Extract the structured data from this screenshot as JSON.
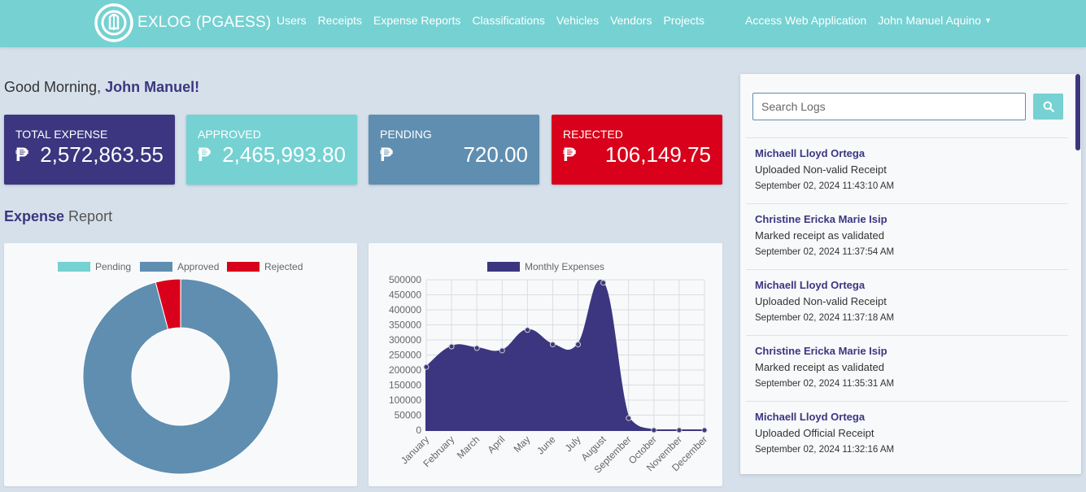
{
  "nav": {
    "brand": "EXLOG (PGAESS)",
    "links": [
      "Users",
      "Receipts",
      "Expense Reports",
      "Classifications",
      "Vehicles",
      "Vendors",
      "Projects"
    ],
    "access": "Access Web Application",
    "user": "John Manuel Aquino"
  },
  "greeting": {
    "prefix": "Good Morning, ",
    "name": "John Manuel!"
  },
  "cards": [
    {
      "title": "TOTAL EXPENSE",
      "currency": "₱",
      "value": "2,572,863.55",
      "color": "#3c3680"
    },
    {
      "title": "APPROVED",
      "currency": "₱",
      "value": "2,465,993.80",
      "color": "#76d1d2"
    },
    {
      "title": "PENDING",
      "currency": "₱",
      "value": "720.00",
      "color": "#5f8eb0"
    },
    {
      "title": "REJECTED",
      "currency": "₱",
      "value": "106,149.75",
      "color": "#d8001a"
    }
  ],
  "section": {
    "bold": "Expense",
    "rest": " Report"
  },
  "search": {
    "placeholder": "Search Logs",
    "value": ""
  },
  "logs": [
    {
      "user": "Michaell Lloyd Ortega",
      "action": "Uploaded Non-valid Receipt",
      "time": "September 02, 2024 11:43:10 AM"
    },
    {
      "user": "Christine Ericka Marie Isip",
      "action": "Marked receipt as validated",
      "time": "September 02, 2024 11:37:54 AM"
    },
    {
      "user": "Michaell Lloyd Ortega",
      "action": "Uploaded Non-valid Receipt",
      "time": "September 02, 2024 11:37:18 AM"
    },
    {
      "user": "Christine Ericka Marie Isip",
      "action": "Marked receipt as validated",
      "time": "September 02, 2024 11:35:31 AM"
    },
    {
      "user": "Michaell Lloyd Ortega",
      "action": "Uploaded Official Receipt",
      "time": "September 02, 2024 11:32:16 AM"
    }
  ],
  "chart_data": [
    {
      "type": "pie",
      "categories": [
        "Pending",
        "Approved",
        "Rejected"
      ],
      "values": [
        720.0,
        2465993.8,
        106149.75
      ],
      "colors": [
        "#76d1d2",
        "#5f8eb0",
        "#d8001a"
      ],
      "legend": "top"
    },
    {
      "type": "area",
      "categories": [
        "January",
        "February",
        "March",
        "April",
        "May",
        "June",
        "July",
        "August",
        "September",
        "October",
        "November",
        "December"
      ],
      "series": [
        {
          "name": "Monthly Expenses",
          "values": [
            210000,
            278000,
            273000,
            265000,
            333000,
            285000,
            285000,
            490000,
            40000,
            0,
            0,
            0
          ]
        }
      ],
      "ylim": [
        0,
        500000
      ],
      "yticks": [
        0,
        50000,
        100000,
        150000,
        200000,
        250000,
        300000,
        350000,
        400000,
        450000,
        500000
      ],
      "grid": true,
      "legend": "top",
      "color": "#3c3680"
    }
  ]
}
